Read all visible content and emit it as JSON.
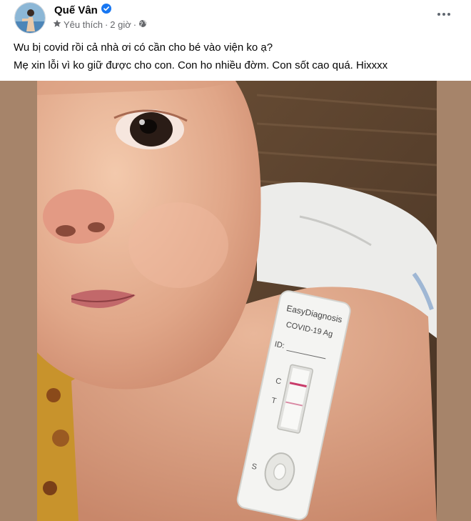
{
  "author": {
    "name": "Quế Vân",
    "verified_icon": "verified-badge-icon"
  },
  "meta": {
    "star_icon": "star-icon",
    "favorite_label": "Yêu thích",
    "separator": "·",
    "time": "2 giờ",
    "privacy_icon": "globe-icon"
  },
  "post": {
    "line1": "Wu bị covid rồi cả nhà ơi có cần cho bé vào viện ko ạ?",
    "line2": "Mẹ xin lỗi vì ko giữ được cho con. Con ho nhiều đờm. Con sốt cao quá. Hixxxx"
  },
  "test_kit": {
    "brand": "EasyDiagnosis",
    "product": "COVID-19 Ag",
    "id_label": "ID:",
    "control_label": "C",
    "test_label": "T",
    "sample_label": "S"
  },
  "colors": {
    "verified": "#1877f2",
    "secondary_text": "#65676b",
    "photo_border": "#a6846a"
  }
}
